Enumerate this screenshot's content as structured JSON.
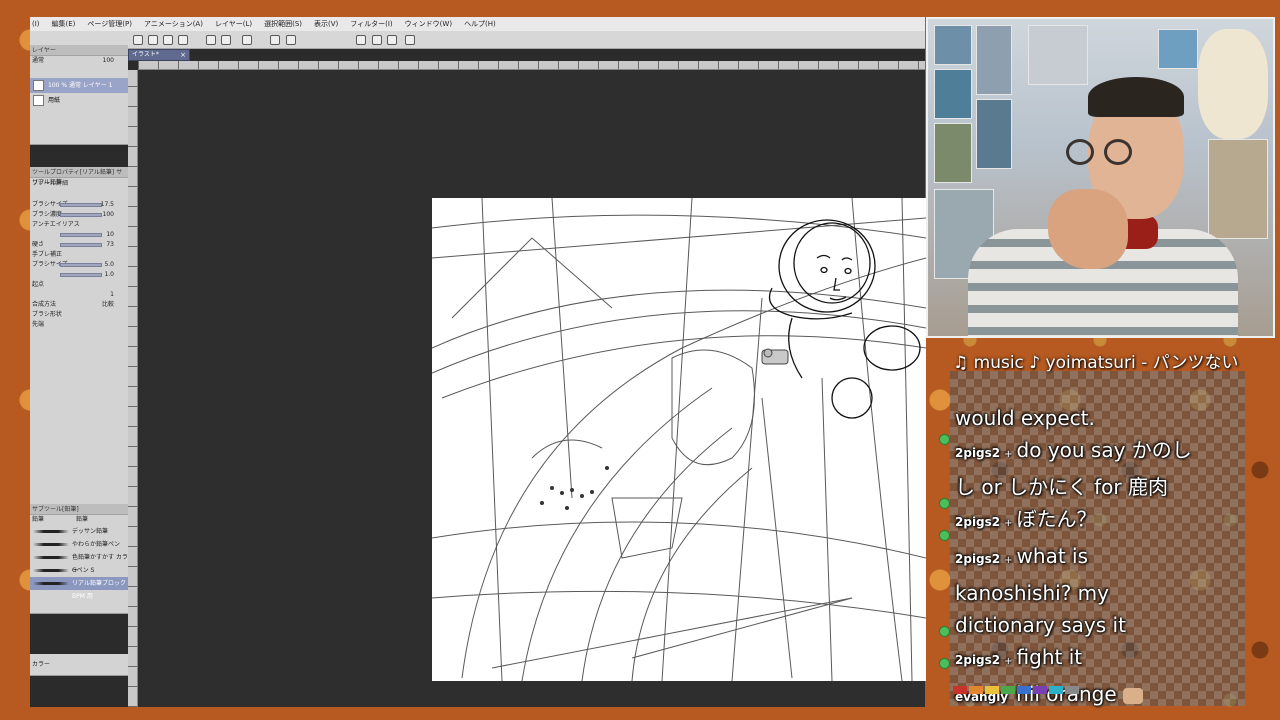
{
  "menu": [
    "(I)",
    "編集(E)",
    "ページ管理(P)",
    "アニメーション(A)",
    "レイヤー(L)",
    "選択範囲(S)",
    "表示(V)",
    "フィルター(I)",
    "ウィンドウ(W)",
    "ヘルプ(H)"
  ],
  "tab": {
    "label": "イラスト*",
    "close": "×"
  },
  "layer_panel": {
    "title": "レイヤー",
    "blend_mode": "通常",
    "opacity": "100",
    "layers": [
      {
        "label": "100 % 通常 レイヤー 1"
      },
      {
        "label": "用紙"
      }
    ]
  },
  "tool_property": {
    "title": "ツールプロパティ[リアル鉛筆] サブツール詳細",
    "tool_name": "リアル鉛筆",
    "rows": [
      {
        "label": "ブラシサイズ",
        "value": "17.5"
      },
      {
        "label": "ブラシ濃度",
        "value": "100"
      },
      {
        "label": "アンチエイリアス",
        "value": ""
      },
      {
        "label": "",
        "value": "10"
      },
      {
        "label": "硬さ",
        "value": "73"
      },
      {
        "label": "手ブレ補正",
        "value": ""
      },
      {
        "label": "ブラシサイズ",
        "value": "5.0"
      },
      {
        "label": "",
        "value": "1.0"
      },
      {
        "label": "起点",
        "value": ""
      },
      {
        "label": "",
        "value": "1"
      },
      {
        "label": "合成方法",
        "value": "比較"
      },
      {
        "label": "ブラシ形状",
        "value": ""
      },
      {
        "label": "先端",
        "value": ""
      }
    ]
  },
  "subtool_panel": {
    "title": "サブツール[鉛筆]",
    "tabs": [
      "鉛筆",
      "鉛筆"
    ],
    "brushes": [
      {
        "label": "デッサン鉛筆"
      },
      {
        "label": "やわらか鉛筆ペン"
      },
      {
        "label": "色鉛筆かすかす カラー"
      },
      {
        "label": "Gペン S"
      },
      {
        "label": "リアル鉛筆ブロック BPM 用"
      }
    ]
  },
  "color_panel": {
    "label": "カラー"
  },
  "music": "♫ music ♪ yoimatsuri - パンツない",
  "chat": [
    {
      "user": "",
      "text": "would expect."
    },
    {
      "user": "2pigs2",
      "text": "do you say かのし"
    },
    {
      "user": "",
      "text": "し or しかにく for 鹿肉"
    },
    {
      "user": "2pigs2",
      "text": "ぼたん？"
    },
    {
      "user": "2pigs2",
      "text": "what is"
    },
    {
      "user": "",
      "text": "kanoshishi? my"
    },
    {
      "user": "",
      "text": "dictionary says it"
    },
    {
      "user": "2pigs2",
      "text": "fight it"
    },
    {
      "user": "evangly",
      "text": "hii orange"
    }
  ],
  "colors": {
    "accent": "#5f6a8e",
    "palette": [
      "#c8342c",
      "#e0862e",
      "#e7c23a",
      "#4aa84a",
      "#3a6fd0",
      "#7a3fb2",
      "#2ab0c8",
      "#888888"
    ]
  }
}
